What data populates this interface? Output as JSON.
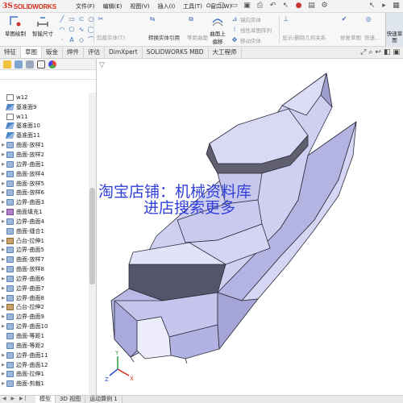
{
  "app": {
    "logo_ds": "3S",
    "logo_name": "SOLIDWORKS"
  },
  "menu": [
    "文件(F)",
    "编辑(E)",
    "视图(V)",
    "插入(I)",
    "工具(T)",
    "窗口(W)"
  ],
  "ribbon": {
    "sketch_draw": "草图绘制",
    "smart_dim": "智能尺寸",
    "trim_entities": "剪裁实体(T)",
    "convert_entities": "转换实体引用",
    "offset_surface": "等距曲面",
    "surface_offset": "曲面上偏移",
    "mirror_entities": "镜向实体",
    "linear_pattern": "线性草图阵列",
    "move_entities": "移动实体",
    "display_relations": "显示/删除几何关系",
    "repair_sketch": "修复草图",
    "quick_snaps": "快速...",
    "quick_sketch": "快速草图"
  },
  "tabs": [
    "特征",
    "草图",
    "钣金",
    "焊件",
    "评估",
    "DimXpert",
    "SOLIDWORKS MBD",
    "大工程师"
  ],
  "active_tab": "草图",
  "tree": [
    {
      "label": "w12",
      "icon": "sketch",
      "arrow": false
    },
    {
      "label": "基准面9",
      "icon": "plane",
      "arrow": false
    },
    {
      "label": "w11",
      "icon": "sketch",
      "arrow": false
    },
    {
      "label": "基准面10",
      "icon": "plane",
      "arrow": false
    },
    {
      "label": "基准面11",
      "icon": "plane",
      "arrow": false
    },
    {
      "label": "曲面-放样1",
      "icon": "surf",
      "arrow": true
    },
    {
      "label": "曲面-放样2",
      "icon": "surf",
      "arrow": true
    },
    {
      "label": "边界-曲面1",
      "icon": "surf",
      "arrow": true
    },
    {
      "label": "曲面-放样4",
      "icon": "surf",
      "arrow": true
    },
    {
      "label": "曲面-放样5",
      "icon": "surf",
      "arrow": true
    },
    {
      "label": "曲面-放样6",
      "icon": "surf",
      "arrow": true
    },
    {
      "label": "边界-曲面3",
      "icon": "surf",
      "arrow": true
    },
    {
      "label": "曲面填充1",
      "icon": "fill",
      "arrow": true
    },
    {
      "label": "边界-曲面4",
      "icon": "surf",
      "arrow": true
    },
    {
      "label": "曲面-缝合1",
      "icon": "surf",
      "arrow": false
    },
    {
      "label": "凸台-拉伸1",
      "icon": "boss",
      "arrow": true
    },
    {
      "label": "边界-曲面5",
      "icon": "surf",
      "arrow": true
    },
    {
      "label": "曲面-放样7",
      "icon": "surf",
      "arrow": true
    },
    {
      "label": "曲面-放样8",
      "icon": "surf",
      "arrow": true
    },
    {
      "label": "边界-曲面6",
      "icon": "surf",
      "arrow": true
    },
    {
      "label": "边界-曲面7",
      "icon": "surf",
      "arrow": true
    },
    {
      "label": "边界-曲面8",
      "icon": "surf",
      "arrow": true
    },
    {
      "label": "凸台-拉伸2",
      "icon": "boss",
      "arrow": true
    },
    {
      "label": "边界-曲面9",
      "icon": "surf",
      "arrow": true
    },
    {
      "label": "边界-曲面10",
      "icon": "surf",
      "arrow": true
    },
    {
      "label": "曲面-等距1",
      "icon": "surf",
      "arrow": false
    },
    {
      "label": "曲面-等距2",
      "icon": "surf",
      "arrow": false
    },
    {
      "label": "边界-曲面11",
      "icon": "surf",
      "arrow": true
    },
    {
      "label": "边界-曲面12",
      "icon": "surf",
      "arrow": true
    },
    {
      "label": "曲面-拉伸1",
      "icon": "surf",
      "arrow": true
    },
    {
      "label": "曲面-剪裁1",
      "icon": "surf",
      "arrow": true
    }
  ],
  "watermark": {
    "line1": "淘宝店铺：机械资料库",
    "line2": "进店搜索更多"
  },
  "bottom_tabs": [
    "模型",
    "3D 视图",
    "运动算例 1"
  ],
  "bottom_nav": "◀ ▶ ▶|",
  "axes": {
    "x": "X",
    "y": "Y",
    "z": "Z"
  },
  "colors": {
    "model_fill": "#c9c9ef",
    "model_edge": "#2b2b3a",
    "dark_band": "#5a5a6b",
    "accent_red": "#d52b1e",
    "watermark": "#2f3fd8"
  }
}
